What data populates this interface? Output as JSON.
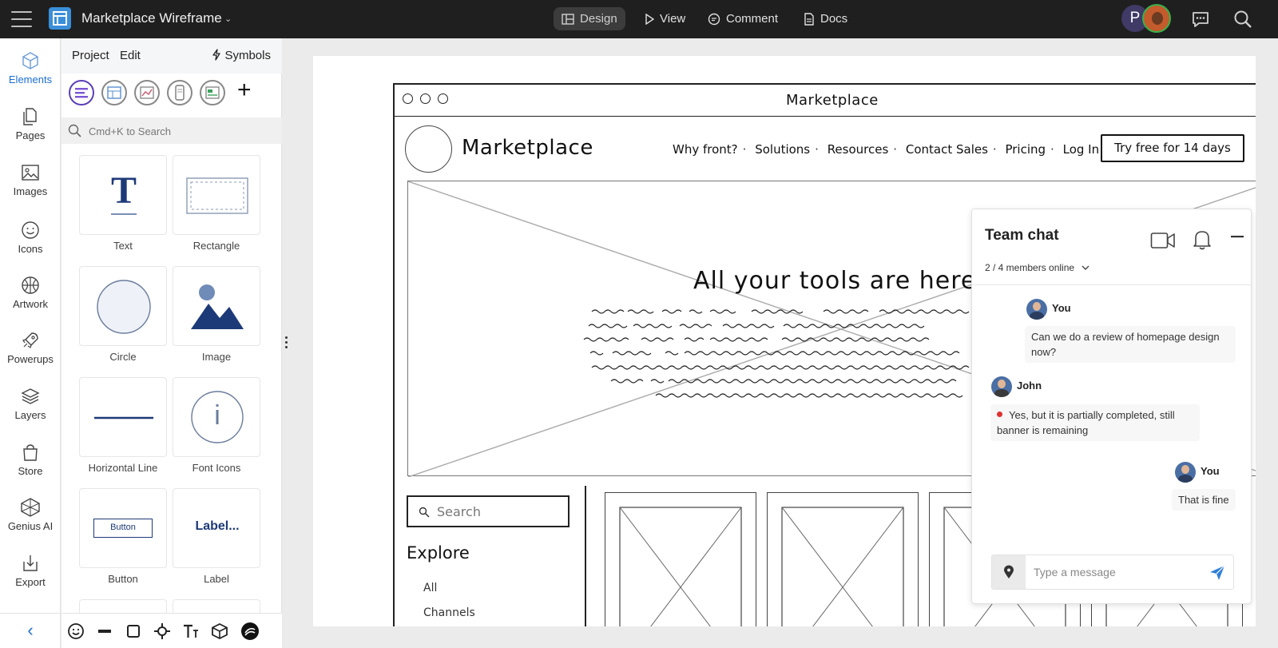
{
  "app": {
    "title": "Marketplace Wireframe",
    "modes": [
      {
        "label": "Design",
        "icon": "layout-icon",
        "active": true
      },
      {
        "label": "View",
        "icon": "play-icon",
        "active": false
      },
      {
        "label": "Comment",
        "icon": "comment-icon",
        "active": false
      },
      {
        "label": "Docs",
        "icon": "document-icon",
        "active": false
      }
    ],
    "avatar_initial": "P"
  },
  "rail": {
    "items": [
      {
        "label": "Elements",
        "icon": "cube-icon",
        "active": true
      },
      {
        "label": "Pages",
        "icon": "pages-icon"
      },
      {
        "label": "Images",
        "icon": "image-icon"
      },
      {
        "label": "Icons",
        "icon": "smiley-icon"
      },
      {
        "label": "Artwork",
        "icon": "artwork-icon"
      },
      {
        "label": "Powerups",
        "icon": "rocket-icon"
      },
      {
        "label": "Layers",
        "icon": "layers-icon"
      },
      {
        "label": "Store",
        "icon": "store-icon"
      },
      {
        "label": "Genius AI",
        "icon": "genius-icon"
      },
      {
        "label": "Export",
        "icon": "export-icon"
      }
    ],
    "collapse_glyph": "‹"
  },
  "panel": {
    "tabs": [
      "Project",
      "Edit"
    ],
    "symbols_label": "Symbols",
    "search_placeholder": "Cmd+K to Search",
    "tiles": [
      {
        "label": "Text",
        "icon": "text-icon",
        "glyph": "T"
      },
      {
        "label": "Rectangle",
        "icon": "rectangle-icon"
      },
      {
        "label": "Circle",
        "icon": "circle-icon"
      },
      {
        "label": "Image",
        "icon": "image-shape-icon"
      },
      {
        "label": "Horizontal Line",
        "icon": "horizontal-line-icon"
      },
      {
        "label": "Font Icons",
        "icon": "font-icons-icon",
        "glyph": "i"
      },
      {
        "label": "Button",
        "icon": "button-shape-icon",
        "glyph": "Button"
      },
      {
        "label": "Label",
        "icon": "label-shape-icon",
        "glyph": "Label..."
      }
    ]
  },
  "wireframe": {
    "window_title": "Marketplace",
    "brand": "Marketplace",
    "nav": [
      "Why front?",
      "Solutions",
      "Resources",
      "Contact Sales",
      "Pricing",
      "Log In"
    ],
    "nav_separator": "·",
    "cta": "Try free for 14 days",
    "hero_title": "All your tools are here",
    "search_label": "Search",
    "explore_title": "Explore",
    "explore_links": [
      "All",
      "Channels"
    ]
  },
  "chat": {
    "title": "Team chat",
    "online": "2 / 4 members online",
    "messages": [
      {
        "author": "You",
        "text": "Can we do a review of homepage design now?"
      },
      {
        "author": "John",
        "text": "Yes, but it is partially completed, still banner is remaining"
      },
      {
        "author": "You",
        "text": "That is fine"
      }
    ],
    "input_placeholder": "Type a message"
  }
}
